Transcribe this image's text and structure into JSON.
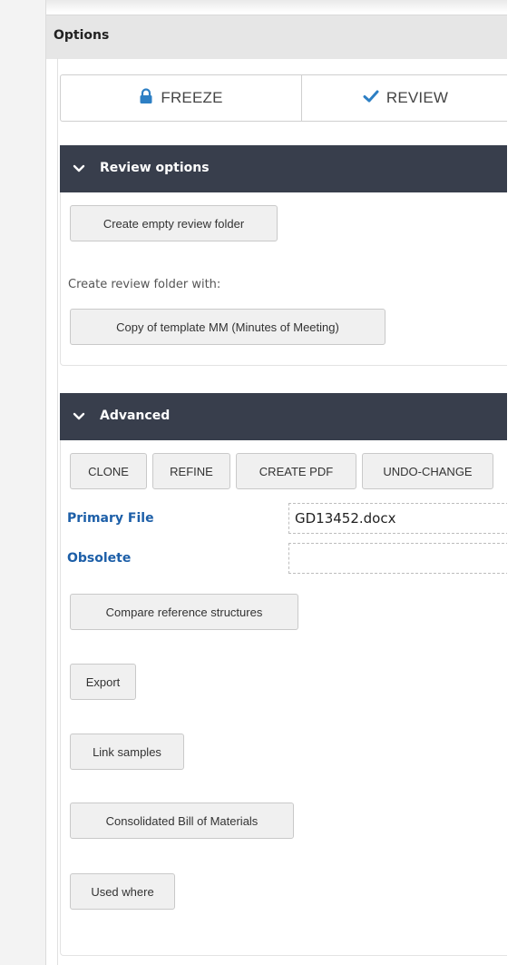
{
  "options": {
    "title": "Options"
  },
  "tabs": [
    {
      "label": "FREEZE",
      "icon": "lock-icon"
    },
    {
      "label": "REVIEW",
      "icon": "check-icon"
    }
  ],
  "review_options": {
    "title": "Review options",
    "create_empty_label": "Create empty review folder",
    "with_text": "Create review folder with:",
    "copy_template_label": "Copy of template MM (Minutes of Meeting)"
  },
  "advanced": {
    "title": "Advanced",
    "actions": [
      "CLONE",
      "REFINE",
      "CREATE PDF",
      "UNDO-CHANGE"
    ],
    "fields": [
      {
        "label": "Primary File",
        "value": "GD13452.docx"
      },
      {
        "label": "Obsolete",
        "value": ""
      }
    ],
    "buttons": [
      "Compare reference structures",
      "Export",
      "Link samples",
      "Consolidated Bill of Materials",
      "Used where"
    ]
  },
  "colors": {
    "accordion_header": "#383e4c",
    "field_label": "#1d5fa8",
    "check_icon": "#2d7fc4"
  }
}
